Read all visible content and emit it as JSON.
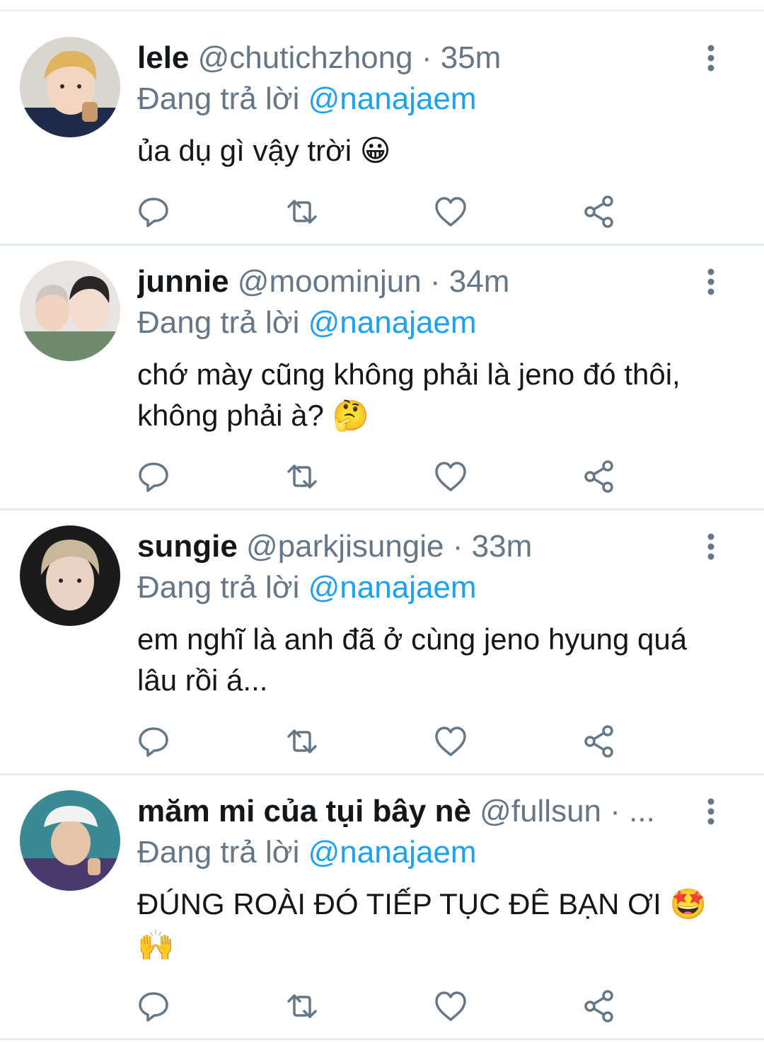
{
  "reply_prefix": "Đang trả lời",
  "tweets": [
    {
      "name": "lele",
      "handle": "@chutichzhong",
      "separator": "·",
      "time": "35m",
      "reply_to": "@nanajaem",
      "text": "ủa dụ gì vậy trời 😀"
    },
    {
      "name": "junnie",
      "handle": "@moominjun",
      "separator": "·",
      "time": "34m",
      "reply_to": "@nanajaem",
      "text": "chớ mày cũng không phải là jeno đó thôi, không phải à? 🤔"
    },
    {
      "name": "sungie",
      "handle": "@parkjisungie",
      "separator": "·",
      "time": "33m",
      "reply_to": "@nanajaem",
      "text": "em nghĩ là anh đã ở cùng jeno hyung quá lâu rồi á..."
    },
    {
      "name": "măm mi của tụi bây nè",
      "handle": "@fullsun",
      "separator": "·",
      "time": "...",
      "reply_to": "@nanajaem",
      "text": "ĐÚNG ROÀI ĐÓ TIẾP TỤC ĐÊ BẠN ƠI 🤩🙌"
    }
  ],
  "icons": {
    "reply": "reply-icon",
    "retweet": "retweet-icon",
    "like": "like-icon",
    "share": "share-icon",
    "more": "more-vertical-icon"
  },
  "colors": {
    "text": "#14171a",
    "muted": "#657786",
    "link": "#1da1f2",
    "divider": "#e6ecf0"
  }
}
